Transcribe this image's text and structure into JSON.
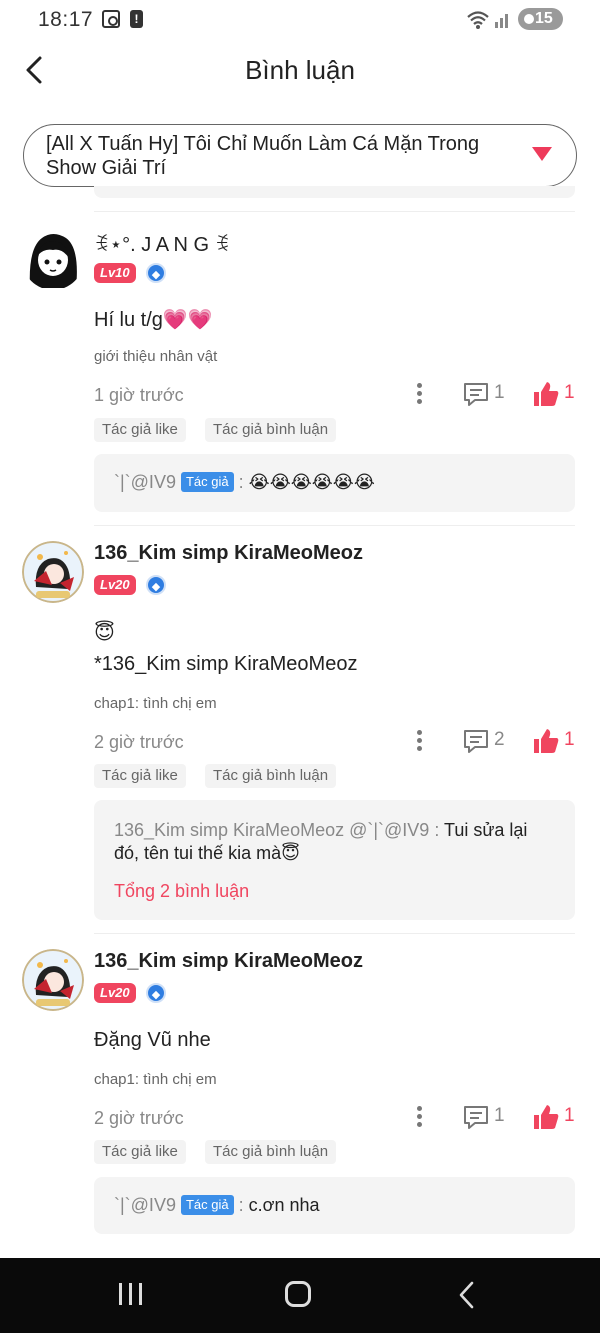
{
  "status_bar": {
    "time": "18:17",
    "battery": "15",
    "alert_icon": "!"
  },
  "header": {
    "title": "Bình luận",
    "back_icon": "chevron-left-icon"
  },
  "chapter_select": {
    "selected": "[All X Tuấn Hy] Tôi Chỉ Muốn Làm Cá Mặn Trong Show Giải Trí"
  },
  "comments": [
    {
      "username": "ꉂ⋆°. J A N G ꉂ",
      "level": "Lv10",
      "text": "Hí lu t/g💗💗",
      "chapter": "giới thiệu nhân vật",
      "time": "1 giờ trước",
      "reply_count": "1",
      "like_count": "1",
      "tags": [
        "Tác giả like",
        "Tác giả bình luận"
      ],
      "reply": {
        "author": "`|`@IV9",
        "author_tag": "Tác giả",
        "sep": ": ",
        "message": "😭😭😭😭😭😭"
      }
    },
    {
      "username": "136_Kim simp KiraMeoMeoz",
      "level": "Lv20",
      "text_line1": "😇",
      "text_line2": "*136_Kim simp KiraMeoMeoz",
      "chapter": "chap1: tình chị em",
      "time": "2 giờ trước",
      "reply_count": "2",
      "like_count": "1",
      "tags": [
        "Tác giả like",
        "Tác giả bình luận"
      ],
      "reply": {
        "prefix": "136_Kim simp KiraMeoMeoz @`|`@IV9 : ",
        "message_line1": "Tui sửa lại",
        "message_line2": "đó, tên tui thế kia mà😇",
        "total": "Tổng 2 bình luận"
      }
    },
    {
      "username": "136_Kim simp KiraMeoMeoz",
      "level": "Lv20",
      "text": "Đặng Vũ nhe",
      "chapter": "chap1: tình chị em",
      "time": "2 giờ trước",
      "reply_count": "1",
      "like_count": "1",
      "tags": [
        "Tác giả like",
        "Tác giả bình luận"
      ],
      "reply": {
        "author": "`|`@IV9",
        "author_tag": "Tác giả",
        "sep": ": ",
        "message": "c.ơn nha"
      }
    }
  ],
  "colors": {
    "accent": "#f0455f",
    "author_tag": "#3b8ee8",
    "level_badge": "#f0455f"
  }
}
